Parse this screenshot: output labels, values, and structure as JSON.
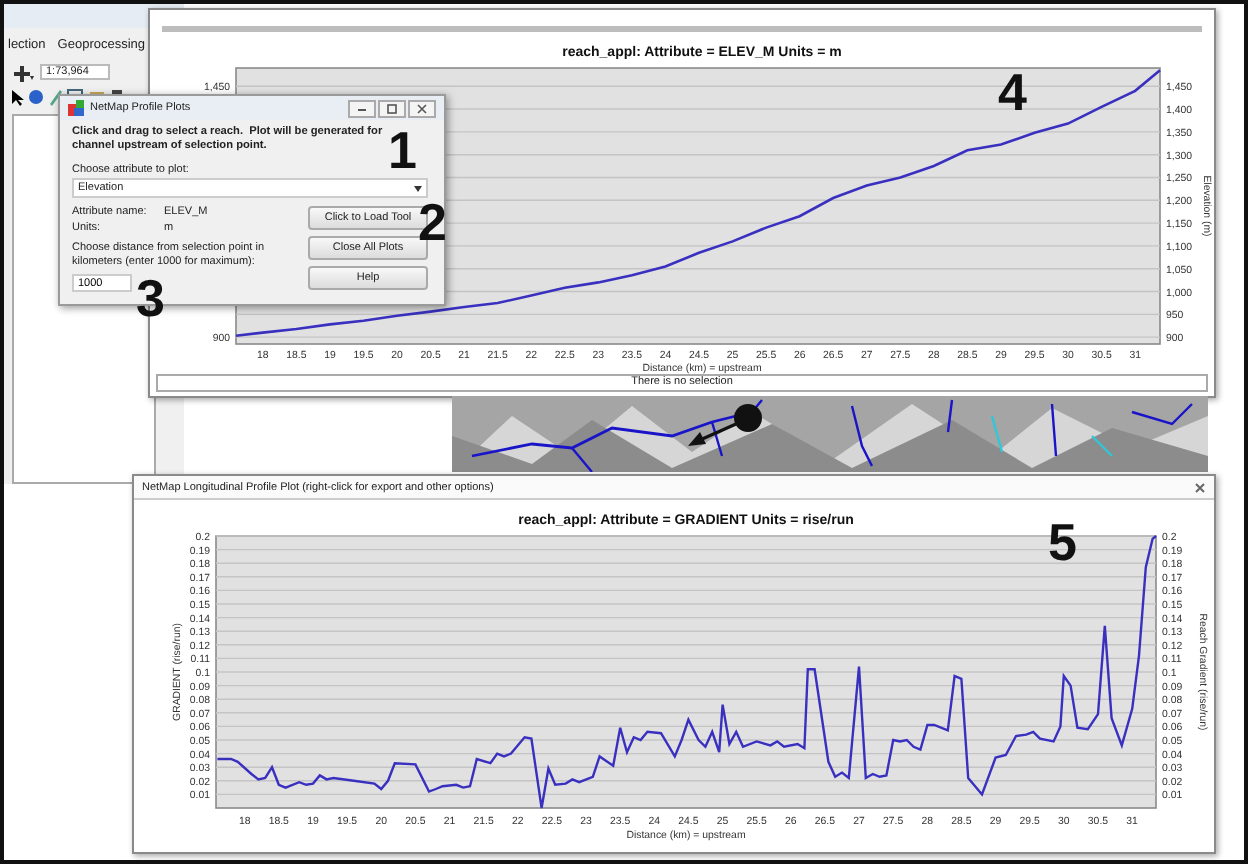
{
  "background_app": {
    "menu": [
      "lection",
      "Geoprocessing"
    ],
    "scale": "1:73,964"
  },
  "elevation_window": {
    "chart_data": {
      "type": "line",
      "title": "reach_appl: Attribute = ELEV_M Units = m",
      "xlabel": "Distance (km) = upstream",
      "ylabel": "Elevation (m)",
      "x": [
        17.6,
        18,
        18.5,
        19,
        19.5,
        20,
        20.5,
        21,
        21.5,
        22,
        22.5,
        23,
        23.5,
        24,
        24.5,
        25,
        25.5,
        26,
        26.5,
        27,
        27.5,
        28,
        28.5,
        29,
        29.5,
        30,
        30.5,
        31,
        31.37
      ],
      "series": [
        {
          "color": "#3a30c0",
          "values": [
            903,
            910,
            918,
            928,
            936,
            947,
            956,
            966,
            975,
            991,
            1008,
            1020,
            1036,
            1055,
            1085,
            1110,
            1140,
            1165,
            1205,
            1232,
            1250,
            1275,
            1310,
            1322,
            1348,
            1368,
            1405,
            1440,
            1485
          ]
        }
      ],
      "xlim": [
        17.6,
        31.37
      ],
      "ylim": [
        885,
        1490
      ],
      "grid": true,
      "xticks": [
        18,
        18.5,
        19,
        19.5,
        20,
        20.5,
        21,
        21.5,
        22,
        22.5,
        23,
        23.5,
        24,
        24.5,
        25,
        25.5,
        26,
        26.5,
        27,
        27.5,
        28,
        28.5,
        29,
        29.5,
        30,
        30.5,
        31
      ],
      "yticks": [
        {
          "value": 900,
          "label": "900"
        },
        {
          "value": 950,
          "label": "950"
        },
        {
          "value": 1000,
          "label": "1,000"
        },
        {
          "value": 1050,
          "label": "1,050"
        },
        {
          "value": 1100,
          "label": "1,100"
        },
        {
          "value": 1150,
          "label": "1,150"
        },
        {
          "value": 1200,
          "label": "1,200"
        },
        {
          "value": 1250,
          "label": "1,250"
        },
        {
          "value": 1300,
          "label": "1,300"
        },
        {
          "value": 1350,
          "label": "1,350"
        },
        {
          "value": 1400,
          "label": "1,400"
        },
        {
          "value": 1450,
          "label": "1,450"
        }
      ]
    },
    "left_yticks": [
      "1,450",
      "900"
    ],
    "status": "There is no selection"
  },
  "profile_dialog": {
    "title": "NetMap Profile Plots",
    "instructions": "Click and drag to select a reach.  Plot will be generated for channel upstream of selection point.",
    "attribute_label": "Choose attribute to plot:",
    "attribute": "Elevation",
    "fields": [
      {
        "label": "Attribute name:",
        "value": "ELEV_M"
      },
      {
        "label": "Units:",
        "value": "m"
      }
    ],
    "distance_label": "Choose distance from selection point in kilometers (enter 1000 for maximum):",
    "distance_value": "1000",
    "buttons": [
      "Click to Load Tool",
      "Close All Plots",
      "Help"
    ]
  },
  "gradient_window": {
    "title": "NetMap Longitudinal Profile Plot (right-click for export and other options)",
    "right_ylabel": "Reach Gradient (rise/run)",
    "left_yticks": [
      "0.2",
      "0.19",
      "0.18",
      "0.17",
      "0.16",
      "0.15",
      "0.14",
      "0.13",
      "0.12",
      "0.11",
      "0.1",
      "0.09",
      "0.08",
      "0.07",
      "0.06",
      "0.05",
      "0.04",
      "0.03",
      "0.02",
      "0.01"
    ],
    "chart_data": {
      "type": "line",
      "title": "reach_appl: Attribute = GRADIENT Units = rise/run",
      "xlabel": "Distance (km) = upstream",
      "ylabel": "GRADIENT (rise/run)",
      "x": [
        17.6,
        17.8,
        17.9,
        18.1,
        18.2,
        18.3,
        18.4,
        18.5,
        18.6,
        18.8,
        18.9,
        19.0,
        19.1,
        19.2,
        19.3,
        19.6,
        19.9,
        20.0,
        20.1,
        20.2,
        20.5,
        20.7,
        20.8,
        20.9,
        21.1,
        21.2,
        21.3,
        21.4,
        21.6,
        21.7,
        21.8,
        21.9,
        22.1,
        22.2,
        22.35,
        22.45,
        22.55,
        22.7,
        22.8,
        22.9,
        23.1,
        23.2,
        23.4,
        23.5,
        23.6,
        23.7,
        23.8,
        23.9,
        24.1,
        24.3,
        24.4,
        24.5,
        24.65,
        24.75,
        24.85,
        24.95,
        25.0,
        25.1,
        25.2,
        25.3,
        25.5,
        25.7,
        25.8,
        25.9,
        26.1,
        26.2,
        26.25,
        26.35,
        26.55,
        26.65,
        26.75,
        26.85,
        27.0,
        27.1,
        27.2,
        27.3,
        27.4,
        27.5,
        27.6,
        27.7,
        27.8,
        27.9,
        28.0,
        28.1,
        28.3,
        28.4,
        28.5,
        28.6,
        28.8,
        29.0,
        29.15,
        29.3,
        29.45,
        29.55,
        29.65,
        29.85,
        29.95,
        30.0,
        30.1,
        30.2,
        30.35,
        30.5,
        30.6,
        30.7,
        30.85,
        31.0,
        31.1,
        31.2,
        31.3,
        31.35
      ],
      "series": [
        {
          "color": "#3a30c0",
          "values": [
            0.036,
            0.036,
            0.034,
            0.025,
            0.021,
            0.022,
            0.03,
            0.017,
            0.015,
            0.019,
            0.017,
            0.018,
            0.024,
            0.021,
            0.022,
            0.02,
            0.018,
            0.014,
            0.02,
            0.033,
            0.032,
            0.012,
            0.014,
            0.016,
            0.017,
            0.015,
            0.016,
            0.036,
            0.033,
            0.04,
            0.038,
            0.04,
            0.052,
            0.051,
            0.0,
            0.029,
            0.017,
            0.018,
            0.021,
            0.019,
            0.023,
            0.038,
            0.031,
            0.059,
            0.041,
            0.052,
            0.05,
            0.056,
            0.055,
            0.038,
            0.05,
            0.065,
            0.05,
            0.045,
            0.056,
            0.041,
            0.076,
            0.047,
            0.056,
            0.045,
            0.049,
            0.046,
            0.049,
            0.045,
            0.047,
            0.044,
            0.102,
            0.102,
            0.034,
            0.023,
            0.026,
            0.022,
            0.104,
            0.022,
            0.025,
            0.023,
            0.024,
            0.05,
            0.049,
            0.05,
            0.045,
            0.043,
            0.061,
            0.061,
            0.057,
            0.097,
            0.095,
            0.022,
            0.01,
            0.037,
            0.039,
            0.053,
            0.054,
            0.056,
            0.051,
            0.049,
            0.06,
            0.097,
            0.09,
            0.059,
            0.058,
            0.069,
            0.134,
            0.066,
            0.046,
            0.073,
            0.112,
            0.177,
            0.198,
            0.2
          ]
        }
      ],
      "xlim": [
        17.58,
        31.35
      ],
      "ylim": [
        0,
        0.2
      ],
      "grid": true,
      "xticks": [
        18,
        18.5,
        19,
        19.5,
        20,
        20.5,
        21,
        21.5,
        22,
        22.5,
        23,
        23.5,
        24,
        24.5,
        25,
        25.5,
        26,
        26.5,
        27,
        27.5,
        28,
        28.5,
        29,
        29.5,
        30,
        30.5,
        31
      ],
      "yticks": [
        0.01,
        0.02,
        0.03,
        0.04,
        0.05,
        0.06,
        0.07,
        0.08,
        0.09,
        0.1,
        0.11,
        0.12,
        0.13,
        0.14,
        0.15,
        0.16,
        0.17,
        0.18,
        0.19,
        0.2
      ]
    }
  },
  "callouts": [
    "1",
    "2",
    "3",
    "4",
    "5"
  ]
}
